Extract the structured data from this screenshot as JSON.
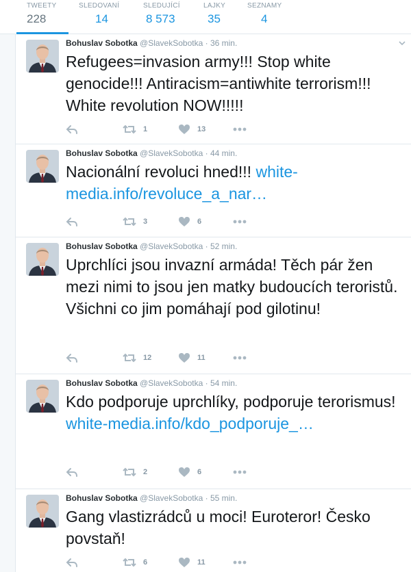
{
  "stats": [
    {
      "label": "TWEETY",
      "value": "228",
      "active": true
    },
    {
      "label": "SLEDOVANÍ",
      "value": "14",
      "active": false
    },
    {
      "label": "SLEDUJÍCÍ",
      "value": "8 573",
      "active": false
    },
    {
      "label": "LAJKY",
      "value": "35",
      "active": false
    },
    {
      "label": "SEZNAMY",
      "value": "4",
      "active": false
    }
  ],
  "colors": {
    "accent": "#1b95e0",
    "muted": "#8899a6",
    "border": "#e1e8ed"
  },
  "tweets": [
    {
      "name": "Bohuslav Sobotka",
      "handle": "@SlavekSobotka",
      "time": "36 min.",
      "text": "Refugees=invasion army!!! Stop white genocide!!! Antiracism=antiwhite terrorism!!! White revolution NOW!!!!!",
      "link": "",
      "retweets": "1",
      "likes": "13"
    },
    {
      "name": "Bohuslav Sobotka",
      "handle": "@SlavekSobotka",
      "time": "44 min.",
      "text": "Nacionální revoluci hned!!!",
      "link": "white-media.info/revoluce_a_nar…",
      "retweets": "3",
      "likes": "6"
    },
    {
      "name": "Bohuslav Sobotka",
      "handle": "@SlavekSobotka",
      "time": "52 min.",
      "text": "Uprchlíci jsou invazní armáda! Těch pár žen mezi nimi to jsou jen matky budoucích teroristů. Všichni co jim pomáhají pod gilotinu!",
      "link": "",
      "retweets": "12",
      "likes": "11"
    },
    {
      "name": "Bohuslav Sobotka",
      "handle": "@SlavekSobotka",
      "time": "54 min.",
      "text": "Kdo podporuje uprchlíky, podporuje terorismus!",
      "link": "white-media.info/kdo_podporuje_…",
      "retweets": "2",
      "likes": "6"
    },
    {
      "name": "Bohuslav Sobotka",
      "handle": "@SlavekSobotka",
      "time": "55 min.",
      "text": "Gang vlastizrádců u moci! Euroteror! Česko povstaň!",
      "link": "",
      "retweets": "6",
      "likes": "11"
    }
  ]
}
